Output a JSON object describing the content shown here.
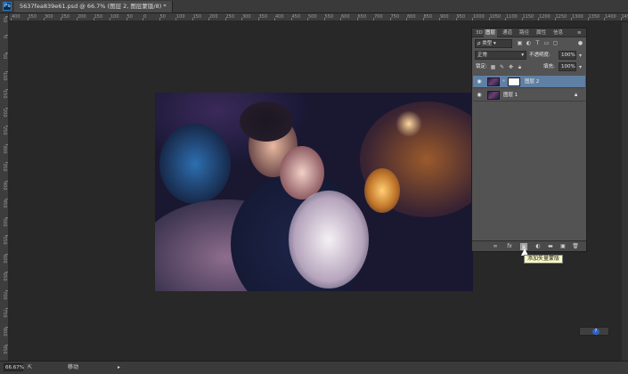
{
  "window": {
    "doc_tab": "5637fea839e61.psd @ 66.7% (图层 2, 图层蒙版/8) *",
    "ps_logo": "Ps"
  },
  "ruler": {
    "top": [
      "400",
      "350",
      "300",
      "250",
      "200",
      "150",
      "100",
      "50",
      "0",
      "50",
      "100",
      "150",
      "200",
      "250",
      "300",
      "350",
      "400",
      "450",
      "500",
      "550",
      "600",
      "650",
      "700",
      "750",
      "800",
      "850",
      "900",
      "950",
      "1000",
      "1050",
      "1100",
      "1150",
      "1200",
      "1250",
      "1300",
      "1350",
      "1400",
      "1450"
    ],
    "left": [
      "50",
      "0",
      "50",
      "100",
      "150",
      "200",
      "250",
      "300",
      "350",
      "400",
      "450",
      "500",
      "550",
      "600",
      "650",
      "700",
      "750",
      "800",
      "850"
    ]
  },
  "panel": {
    "tabs": [
      "3D",
      "图层",
      "通道",
      "路径",
      "属性",
      "信息"
    ],
    "filter_label": "ρ 类型",
    "blend_mode": "正常",
    "opacity_label": "不透明度:",
    "opacity_value": "100%",
    "lock_label": "锁定:",
    "fill_label": "填充:",
    "fill_value": "100%",
    "layers": [
      {
        "name": "图层 2",
        "selected": true,
        "has_mask": true,
        "locked": false
      },
      {
        "name": "图层 1",
        "selected": false,
        "has_mask": false,
        "locked": true
      }
    ],
    "bottom_icons": [
      "link-icon",
      "fx-icon",
      "add-mask-icon",
      "adjustment-icon",
      "folder-icon",
      "new-layer-icon",
      "trash-icon"
    ]
  },
  "tooltip": "添加矢量蒙版",
  "status": {
    "zoom": "66.67%",
    "tool": "移动"
  },
  "colors": {
    "ui_bg": "#282828",
    "panel": "#535353",
    "selected_layer": "#5f7fa3",
    "tooltip_bg": "#fbfbc9"
  }
}
